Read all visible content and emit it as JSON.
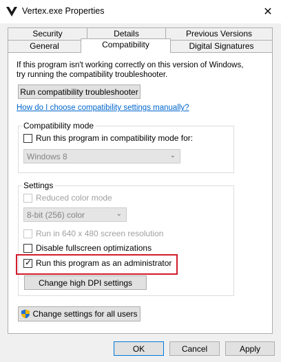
{
  "window": {
    "title": "Vertex.exe Properties",
    "close_glyph": "✕",
    "app_icon": "vertex-logo-icon"
  },
  "tabs": {
    "row1": [
      "Security",
      "Details",
      "Previous Versions"
    ],
    "row2": [
      "General",
      "Compatibility",
      "Digital Signatures"
    ],
    "active": "Compatibility"
  },
  "compat": {
    "intro_line1": "If this program isn't working correctly on this version of Windows,",
    "intro_line2": "try running the compatibility troubleshooter.",
    "troubleshooter_button": "Run compatibility troubleshooter",
    "manual_link": "How do I choose compatibility settings manually?",
    "mode_group_label": "Compatibility mode",
    "mode_checkbox_label": "Run this program in compatibility mode for:",
    "mode_select_value": "Windows 8",
    "settings_group_label": "Settings",
    "reduced_color_label": "Reduced color mode",
    "color_select_value": "8-bit (256) color",
    "run_640_label": "Run in 640 x 480 screen resolution",
    "disable_fullscreen_label": "Disable fullscreen optimizations",
    "run_admin_label": "Run this program as an administrator",
    "run_admin_checked": true,
    "dpi_button": "Change high DPI settings",
    "all_users_button": "Change settings for all users",
    "all_users_icon": "uac-shield-icon"
  },
  "footer": {
    "ok": "OK",
    "cancel": "Cancel",
    "apply": "Apply"
  },
  "colors": {
    "highlight": "#d11a2a",
    "link": "#0066cc",
    "focus_border": "#0078d7"
  }
}
